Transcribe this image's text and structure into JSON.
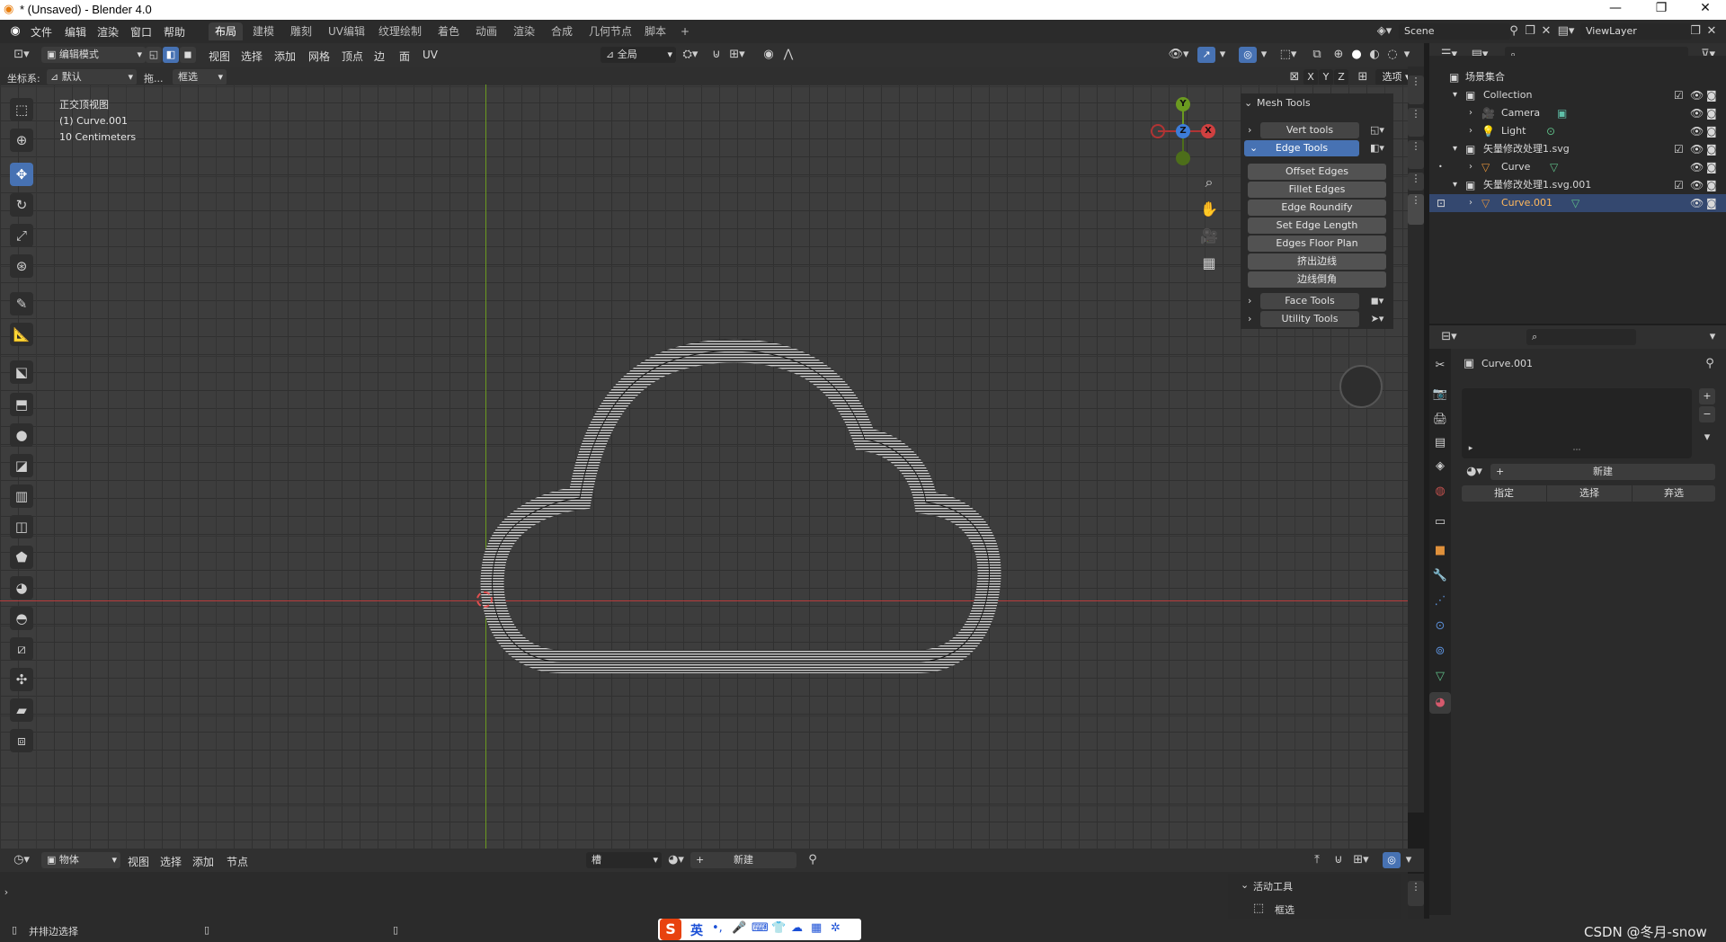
{
  "window": {
    "title": "* (Unsaved) - Blender 4.0",
    "controls": [
      "—",
      "❐",
      "✕"
    ]
  },
  "menu": [
    "文件",
    "编辑",
    "渲染",
    "窗口",
    "帮助"
  ],
  "workspaces": [
    "布局",
    "建模",
    "雕刻",
    "UV编辑",
    "纹理绘制",
    "着色",
    "动画",
    "渲染",
    "合成",
    "几何节点",
    "脚本"
  ],
  "active_workspace": "布局",
  "add_workspace": "+",
  "scene": {
    "name": "Scene",
    "view_layer": "ViewLayer"
  },
  "viewport_header": {
    "mode": "编辑模式",
    "menus": [
      "视图",
      "选择",
      "添加",
      "网格",
      "顶点",
      "边",
      "面",
      "UV"
    ],
    "transform_orientation": "全局",
    "options_label": "选项"
  },
  "tool_settings": {
    "coord_label": "坐标系:",
    "coord_value": "默认",
    "drag_label": "拖...",
    "drag_value": "框选",
    "xyz": [
      "X",
      "Y",
      "Z"
    ]
  },
  "viewport_info": {
    "view_name": "正交顶视图",
    "object": "(1) Curve.001",
    "scale": "10 Centimeters"
  },
  "gizmo": {
    "x": "X",
    "y": "Y",
    "z": "Z"
  },
  "mesh_tools": {
    "title": "Mesh Tools",
    "sections": [
      "Vert tools",
      "Edge Tools",
      "Face Tools",
      "Utility Tools"
    ],
    "edge_items": [
      "Offset Edges",
      "Fillet Edges",
      "Edge Roundify",
      "Set Edge Length",
      "Edges Floor Plan",
      "挤出边线",
      "边线倒角"
    ]
  },
  "outliner": {
    "root": "场景集合",
    "rows": [
      {
        "label": "Collection",
        "level": 1
      },
      {
        "label": "Camera",
        "level": 2
      },
      {
        "label": "Light",
        "level": 2
      },
      {
        "label": "矢量修改处理1.svg",
        "level": 1
      },
      {
        "label": "Curve",
        "level": 2
      },
      {
        "label": "矢量修改处理1.svg.001",
        "level": 1
      },
      {
        "label": "Curve.001",
        "level": 2,
        "selected": true
      }
    ]
  },
  "properties": {
    "object_name": "Curve.001",
    "new_button": "新建",
    "assign": "指定",
    "select": "选择",
    "deselect": "弃选",
    "plus": "+",
    "minus": "−"
  },
  "timeline": {
    "mode": "物体",
    "menus": [
      "视图",
      "选择",
      "添加",
      "节点"
    ],
    "slot": "槽",
    "new": "新建"
  },
  "active_tool_panel": {
    "title": "活动工具",
    "tool": "框选"
  },
  "status": {
    "left": "并排边选择"
  },
  "ime": {
    "label": "S",
    "lang": "英",
    "items": [
      "•,",
      "🎤",
      "⌨",
      "👕",
      "☁",
      "▦",
      "✲"
    ]
  },
  "watermark": "CSDN @冬月-snow",
  "colors": {
    "accent": "#4772b3",
    "x_axis": "#d04040",
    "y_axis": "#6b9a20",
    "z_axis": "#3d7dd9"
  }
}
